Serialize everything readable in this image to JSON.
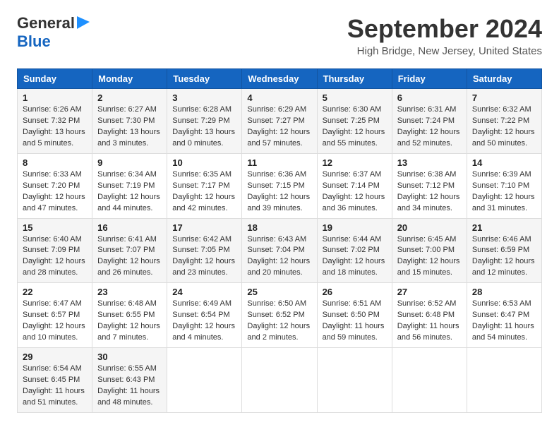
{
  "logo": {
    "line1": "General",
    "line2": "Blue",
    "arrow_color": "#1e90ff"
  },
  "title": "September 2024",
  "location": "High Bridge, New Jersey, United States",
  "days_of_week": [
    "Sunday",
    "Monday",
    "Tuesday",
    "Wednesday",
    "Thursday",
    "Friday",
    "Saturday"
  ],
  "weeks": [
    [
      {
        "day": "1",
        "sunrise": "6:26 AM",
        "sunset": "7:32 PM",
        "daylight": "13 hours and 5 minutes."
      },
      {
        "day": "2",
        "sunrise": "6:27 AM",
        "sunset": "7:30 PM",
        "daylight": "13 hours and 3 minutes."
      },
      {
        "day": "3",
        "sunrise": "6:28 AM",
        "sunset": "7:29 PM",
        "daylight": "13 hours and 0 minutes."
      },
      {
        "day": "4",
        "sunrise": "6:29 AM",
        "sunset": "7:27 PM",
        "daylight": "12 hours and 57 minutes."
      },
      {
        "day": "5",
        "sunrise": "6:30 AM",
        "sunset": "7:25 PM",
        "daylight": "12 hours and 55 minutes."
      },
      {
        "day": "6",
        "sunrise": "6:31 AM",
        "sunset": "7:24 PM",
        "daylight": "12 hours and 52 minutes."
      },
      {
        "day": "7",
        "sunrise": "6:32 AM",
        "sunset": "7:22 PM",
        "daylight": "12 hours and 50 minutes."
      }
    ],
    [
      {
        "day": "8",
        "sunrise": "6:33 AM",
        "sunset": "7:20 PM",
        "daylight": "12 hours and 47 minutes."
      },
      {
        "day": "9",
        "sunrise": "6:34 AM",
        "sunset": "7:19 PM",
        "daylight": "12 hours and 44 minutes."
      },
      {
        "day": "10",
        "sunrise": "6:35 AM",
        "sunset": "7:17 PM",
        "daylight": "12 hours and 42 minutes."
      },
      {
        "day": "11",
        "sunrise": "6:36 AM",
        "sunset": "7:15 PM",
        "daylight": "12 hours and 39 minutes."
      },
      {
        "day": "12",
        "sunrise": "6:37 AM",
        "sunset": "7:14 PM",
        "daylight": "12 hours and 36 minutes."
      },
      {
        "day": "13",
        "sunrise": "6:38 AM",
        "sunset": "7:12 PM",
        "daylight": "12 hours and 34 minutes."
      },
      {
        "day": "14",
        "sunrise": "6:39 AM",
        "sunset": "7:10 PM",
        "daylight": "12 hours and 31 minutes."
      }
    ],
    [
      {
        "day": "15",
        "sunrise": "6:40 AM",
        "sunset": "7:09 PM",
        "daylight": "12 hours and 28 minutes."
      },
      {
        "day": "16",
        "sunrise": "6:41 AM",
        "sunset": "7:07 PM",
        "daylight": "12 hours and 26 minutes."
      },
      {
        "day": "17",
        "sunrise": "6:42 AM",
        "sunset": "7:05 PM",
        "daylight": "12 hours and 23 minutes."
      },
      {
        "day": "18",
        "sunrise": "6:43 AM",
        "sunset": "7:04 PM",
        "daylight": "12 hours and 20 minutes."
      },
      {
        "day": "19",
        "sunrise": "6:44 AM",
        "sunset": "7:02 PM",
        "daylight": "12 hours and 18 minutes."
      },
      {
        "day": "20",
        "sunrise": "6:45 AM",
        "sunset": "7:00 PM",
        "daylight": "12 hours and 15 minutes."
      },
      {
        "day": "21",
        "sunrise": "6:46 AM",
        "sunset": "6:59 PM",
        "daylight": "12 hours and 12 minutes."
      }
    ],
    [
      {
        "day": "22",
        "sunrise": "6:47 AM",
        "sunset": "6:57 PM",
        "daylight": "12 hours and 10 minutes."
      },
      {
        "day": "23",
        "sunrise": "6:48 AM",
        "sunset": "6:55 PM",
        "daylight": "12 hours and 7 minutes."
      },
      {
        "day": "24",
        "sunrise": "6:49 AM",
        "sunset": "6:54 PM",
        "daylight": "12 hours and 4 minutes."
      },
      {
        "day": "25",
        "sunrise": "6:50 AM",
        "sunset": "6:52 PM",
        "daylight": "12 hours and 2 minutes."
      },
      {
        "day": "26",
        "sunrise": "6:51 AM",
        "sunset": "6:50 PM",
        "daylight": "11 hours and 59 minutes."
      },
      {
        "day": "27",
        "sunrise": "6:52 AM",
        "sunset": "6:48 PM",
        "daylight": "11 hours and 56 minutes."
      },
      {
        "day": "28",
        "sunrise": "6:53 AM",
        "sunset": "6:47 PM",
        "daylight": "11 hours and 54 minutes."
      }
    ],
    [
      {
        "day": "29",
        "sunrise": "6:54 AM",
        "sunset": "6:45 PM",
        "daylight": "11 hours and 51 minutes."
      },
      {
        "day": "30",
        "sunrise": "6:55 AM",
        "sunset": "6:43 PM",
        "daylight": "11 hours and 48 minutes."
      },
      null,
      null,
      null,
      null,
      null
    ]
  ],
  "labels": {
    "sunrise": "Sunrise:",
    "sunset": "Sunset:",
    "daylight": "Daylight:"
  }
}
